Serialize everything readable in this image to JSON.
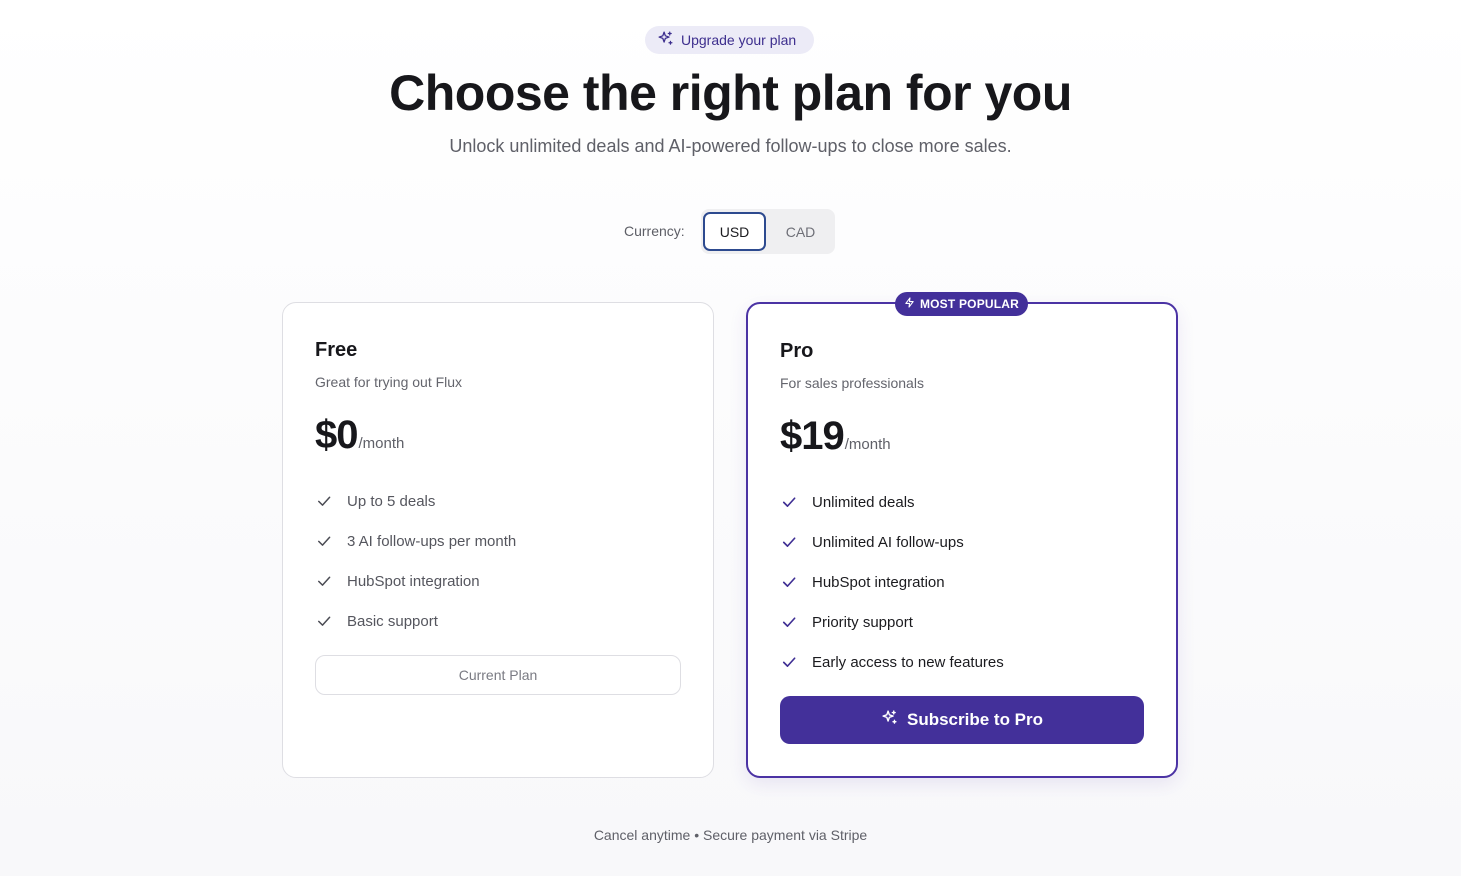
{
  "badge": {
    "label": "Upgrade your plan",
    "icon": "sparkles-icon"
  },
  "header": {
    "title": "Choose the right plan for you",
    "subtitle": "Unlock unlimited deals and AI-powered follow-ups to close more sales."
  },
  "currency": {
    "label": "Currency:",
    "options": [
      "USD",
      "CAD"
    ],
    "selected": "USD"
  },
  "plans": [
    {
      "name": "Free",
      "description": "Great for trying out Flux",
      "price": "$0",
      "period": "/month",
      "features": [
        "Up to 5 deals",
        "3 AI follow-ups per month",
        "HubSpot integration",
        "Basic support"
      ],
      "button_label": "Current Plan"
    },
    {
      "name": "Pro",
      "tag": "MOST POPULAR",
      "description": "For sales professionals",
      "price": "$19",
      "period": "/month",
      "features": [
        "Unlimited deals",
        "Unlimited AI follow-ups",
        "HubSpot integration",
        "Priority support",
        "Early access to new features"
      ],
      "button_label": "Subscribe to Pro"
    }
  ],
  "footer": {
    "note": "Cancel anytime • Secure payment via Stripe"
  },
  "colors": {
    "brand": "#43309a",
    "accent_border": "#2d4a8f",
    "badge_bg": "#ecebf7"
  }
}
